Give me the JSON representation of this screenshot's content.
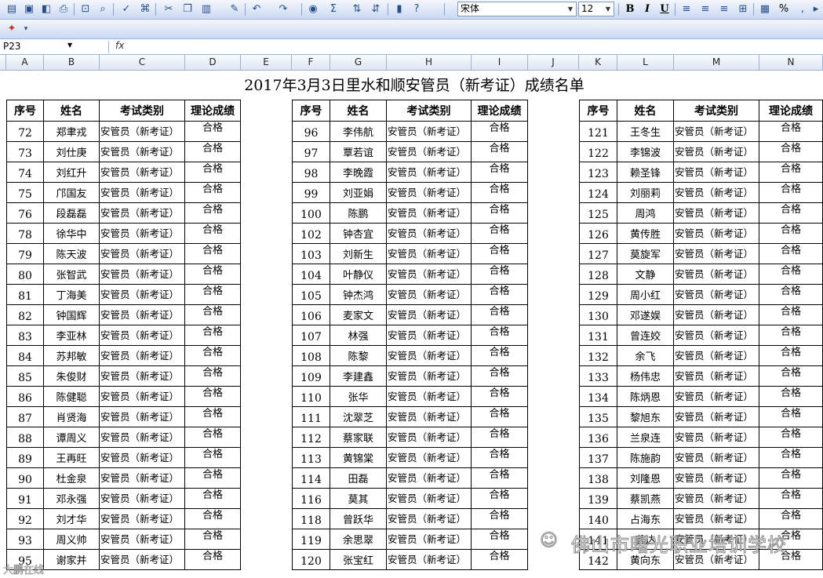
{
  "toolbar": {
    "font_name": "宋体",
    "font_size": "12",
    "bold": "B",
    "italic": "I",
    "underline": "U",
    "sum": "Σ",
    "percent": "%"
  },
  "formula_bar": {
    "cell_ref": "P23",
    "fx": "fx"
  },
  "columns": [
    "A",
    "B",
    "C",
    "D",
    "E",
    "F",
    "G",
    "H",
    "I",
    "J",
    "K",
    "L",
    "M",
    "N"
  ],
  "title": "2017年3月3日里水和顺安管员（新考证）成绩名单",
  "headers": [
    "序号",
    "姓名",
    "考试类别",
    "理论成绩"
  ],
  "category": "安管员（新考证）",
  "result": "合格",
  "blocks": [
    {
      "rows": [
        [
          "72",
          "郑聿戎"
        ],
        [
          "73",
          "刘仕庚"
        ],
        [
          "74",
          "刘红升"
        ],
        [
          "75",
          "邝国友"
        ],
        [
          "76",
          "段磊磊"
        ],
        [
          "78",
          "徐华中"
        ],
        [
          "79",
          "陈天波"
        ],
        [
          "80",
          "张智武"
        ],
        [
          "81",
          "丁海美"
        ],
        [
          "82",
          "钟国辉"
        ],
        [
          "83",
          "李亚林"
        ],
        [
          "84",
          "苏邦敏"
        ],
        [
          "85",
          "朱俊财"
        ],
        [
          "86",
          "陈健聪"
        ],
        [
          "87",
          "肖贤海"
        ],
        [
          "88",
          "谭周义"
        ],
        [
          "89",
          "王再旺"
        ],
        [
          "90",
          "杜金泉"
        ],
        [
          "91",
          "邓永强"
        ],
        [
          "92",
          "刘才华"
        ],
        [
          "93",
          "周义帅"
        ],
        [
          "95",
          "谢家并"
        ]
      ]
    },
    {
      "rows": [
        [
          "96",
          "李伟航"
        ],
        [
          "97",
          "覃若谊"
        ],
        [
          "98",
          "李晚霞"
        ],
        [
          "99",
          "刘亚娟"
        ],
        [
          "100",
          "陈鹏"
        ],
        [
          "102",
          "钟杏宜"
        ],
        [
          "103",
          "刘新生"
        ],
        [
          "104",
          "叶静仪"
        ],
        [
          "105",
          "钟杰鸿"
        ],
        [
          "106",
          "麦家文"
        ],
        [
          "107",
          "林强"
        ],
        [
          "108",
          "陈黎"
        ],
        [
          "109",
          "李建鑫"
        ],
        [
          "110",
          "张华"
        ],
        [
          "111",
          "沈翠芝"
        ],
        [
          "112",
          "蔡家联"
        ],
        [
          "113",
          "黄锦棠"
        ],
        [
          "114",
          "田磊"
        ],
        [
          "116",
          "莫其"
        ],
        [
          "118",
          "曾跃华"
        ],
        [
          "119",
          "余思翠"
        ],
        [
          "120",
          "张宝红"
        ]
      ]
    },
    {
      "rows": [
        [
          "121",
          "王冬生"
        ],
        [
          "122",
          "李锦波"
        ],
        [
          "123",
          "赖圣锋"
        ],
        [
          "124",
          "刘丽莉"
        ],
        [
          "125",
          "周鸿"
        ],
        [
          "126",
          "黄传胜"
        ],
        [
          "127",
          "莫旋军"
        ],
        [
          "128",
          "文静"
        ],
        [
          "129",
          "周小红"
        ],
        [
          "130",
          "邓遂娱"
        ],
        [
          "131",
          "曾连姣"
        ],
        [
          "132",
          "余飞"
        ],
        [
          "133",
          "杨伟忠"
        ],
        [
          "134",
          "陈炳恩"
        ],
        [
          "135",
          "黎旭东"
        ],
        [
          "136",
          "兰泉连"
        ],
        [
          "137",
          "陈施韵"
        ],
        [
          "138",
          "刘隆恩"
        ],
        [
          "139",
          "蔡凯燕"
        ],
        [
          "140",
          "占海东"
        ],
        [
          "141",
          "龚达"
        ],
        [
          "142",
          "黄向东"
        ]
      ]
    }
  ],
  "watermark": "佛山市曙光职业培训学校",
  "watermark_left": "大鹏在线"
}
